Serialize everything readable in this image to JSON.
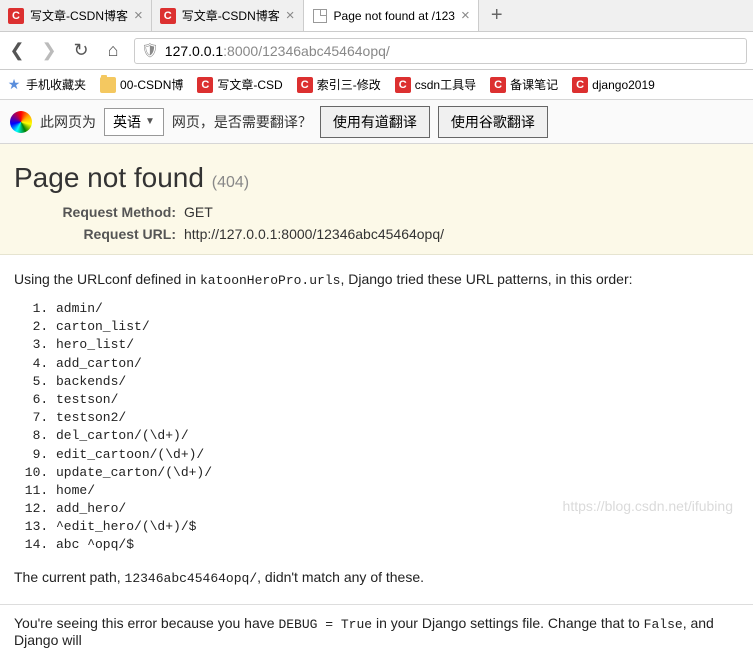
{
  "tabs": {
    "items": [
      {
        "title": "写文章-CSDN博客",
        "favicon": "c",
        "active": false
      },
      {
        "title": "写文章-CSDN博客",
        "favicon": "c",
        "active": false
      },
      {
        "title": "Page not found at /123",
        "favicon": "page",
        "active": true
      }
    ]
  },
  "address": {
    "host": "127.0.0.1",
    "port": ":8000",
    "path": "/12346abc45464opq/"
  },
  "bookmarks": [
    {
      "label": "手机收藏夹",
      "icon": "star"
    },
    {
      "label": "00-CSDN博",
      "icon": "folder"
    },
    {
      "label": "写文章-CSD",
      "icon": "c"
    },
    {
      "label": "索引三-修改",
      "icon": "c"
    },
    {
      "label": "csdn工具导",
      "icon": "c"
    },
    {
      "label": "备课笔记",
      "icon": "c"
    },
    {
      "label": "django2019",
      "icon": "c"
    }
  ],
  "translate": {
    "prefix": "此网页为",
    "lang": "英语",
    "suffix": "网页，是否需要翻译？",
    "btn_youdao": "使用有道翻译",
    "btn_google": "使用谷歌翻译"
  },
  "error": {
    "heading": "Page not found",
    "status": "(404)",
    "method_label": "Request Method:",
    "method_value": "GET",
    "url_label": "Request URL:",
    "url_value": "http://127.0.0.1:8000/12346abc45464opq/"
  },
  "intro_pre": "Using the URLconf defined in ",
  "intro_module": "katoonHeroPro.urls",
  "intro_post": ", Django tried these URL patterns, in this order:",
  "url_patterns": [
    "admin/",
    "carton_list/",
    "hero_list/",
    "add_carton/",
    "backends/",
    "testson/",
    "testson2/",
    "del_carton/(\\d+)/",
    "edit_cartoon/(\\d+)/",
    "update_carton/(\\d+)/",
    "home/",
    "add_hero/",
    "^edit_hero/(\\d+)/$",
    "abc ^opq/$"
  ],
  "nomatch_pre": "The current path, ",
  "nomatch_path": "12346abc45464opq/",
  "nomatch_post": ", didn't match any of these.",
  "debug_pre": "You're seeing this error because you have ",
  "debug_code1": "DEBUG = True",
  "debug_mid": " in your Django settings file. Change that to ",
  "debug_code2": "False",
  "debug_post": ", and Django will",
  "watermark": "https://blog.csdn.net/ifubing"
}
